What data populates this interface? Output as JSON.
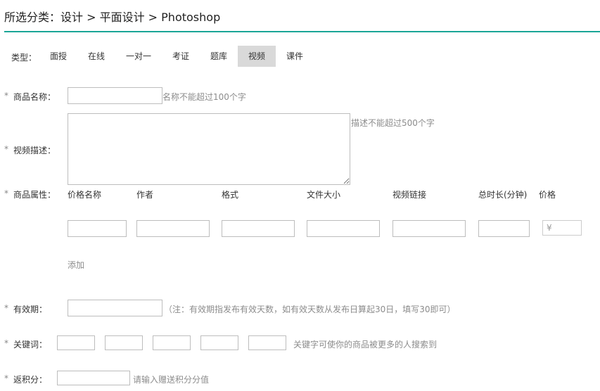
{
  "breadcrumb": "所选分类：设计 > 平面设计 > Photoshop",
  "type_label": "类型：",
  "tabs": [
    {
      "label": "面授",
      "active": false
    },
    {
      "label": "在线",
      "active": false
    },
    {
      "label": "一对一",
      "active": false
    },
    {
      "label": "考证",
      "active": false
    },
    {
      "label": "题库",
      "active": false
    },
    {
      "label": "视频",
      "active": true
    },
    {
      "label": "课件",
      "active": false
    }
  ],
  "required_mark": "*",
  "form": {
    "name_label": "商品名称：",
    "name_hint": "名称不能超过100个字",
    "desc_label": "视频描述：",
    "desc_hint": "描述不能超过500个字",
    "attr_label": "商品属性：",
    "attr_columns": [
      "价格名称",
      "作者",
      "格式",
      "文件大小",
      "视频链接",
      "总时长(分钟)",
      "价格"
    ],
    "price_prefix": "¥",
    "add_label": "添加",
    "validity_label": "有效期：",
    "validity_hint": "（注：有效期指发布有效天数，如有效天数从发布日算起30日，填写30即可）",
    "keywords_label": "关键词：",
    "keywords_hint": "关键字可使你的商品被更多的人搜索到",
    "points_label": "返积分：",
    "points_hint": "请输入赠送积分分值"
  },
  "colors": {
    "accent": "#1aa597",
    "active_tab": "#d9d9d9"
  }
}
